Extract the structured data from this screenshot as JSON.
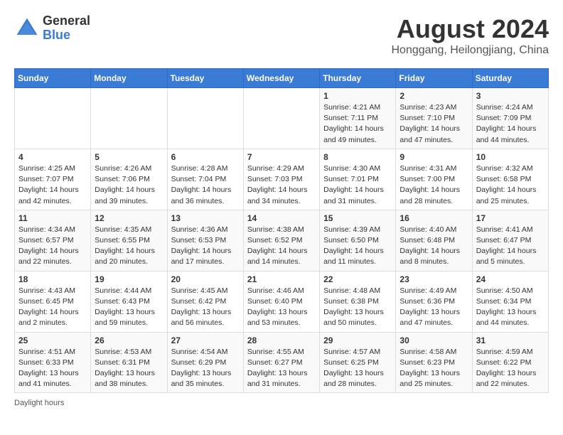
{
  "header": {
    "logo": {
      "general": "General",
      "blue": "Blue"
    },
    "title": "August 2024",
    "subtitle": "Honggang, Heilongjiang, China"
  },
  "calendar": {
    "weekdays": [
      "Sunday",
      "Monday",
      "Tuesday",
      "Wednesday",
      "Thursday",
      "Friday",
      "Saturday"
    ],
    "weeks": [
      [
        {
          "day": "",
          "info": ""
        },
        {
          "day": "",
          "info": ""
        },
        {
          "day": "",
          "info": ""
        },
        {
          "day": "",
          "info": ""
        },
        {
          "day": "1",
          "info": "Sunrise: 4:21 AM\nSunset: 7:11 PM\nDaylight: 14 hours\nand 49 minutes."
        },
        {
          "day": "2",
          "info": "Sunrise: 4:23 AM\nSunset: 7:10 PM\nDaylight: 14 hours\nand 47 minutes."
        },
        {
          "day": "3",
          "info": "Sunrise: 4:24 AM\nSunset: 7:09 PM\nDaylight: 14 hours\nand 44 minutes."
        }
      ],
      [
        {
          "day": "4",
          "info": "Sunrise: 4:25 AM\nSunset: 7:07 PM\nDaylight: 14 hours\nand 42 minutes."
        },
        {
          "day": "5",
          "info": "Sunrise: 4:26 AM\nSunset: 7:06 PM\nDaylight: 14 hours\nand 39 minutes."
        },
        {
          "day": "6",
          "info": "Sunrise: 4:28 AM\nSunset: 7:04 PM\nDaylight: 14 hours\nand 36 minutes."
        },
        {
          "day": "7",
          "info": "Sunrise: 4:29 AM\nSunset: 7:03 PM\nDaylight: 14 hours\nand 34 minutes."
        },
        {
          "day": "8",
          "info": "Sunrise: 4:30 AM\nSunset: 7:01 PM\nDaylight: 14 hours\nand 31 minutes."
        },
        {
          "day": "9",
          "info": "Sunrise: 4:31 AM\nSunset: 7:00 PM\nDaylight: 14 hours\nand 28 minutes."
        },
        {
          "day": "10",
          "info": "Sunrise: 4:32 AM\nSunset: 6:58 PM\nDaylight: 14 hours\nand 25 minutes."
        }
      ],
      [
        {
          "day": "11",
          "info": "Sunrise: 4:34 AM\nSunset: 6:57 PM\nDaylight: 14 hours\nand 22 minutes."
        },
        {
          "day": "12",
          "info": "Sunrise: 4:35 AM\nSunset: 6:55 PM\nDaylight: 14 hours\nand 20 minutes."
        },
        {
          "day": "13",
          "info": "Sunrise: 4:36 AM\nSunset: 6:53 PM\nDaylight: 14 hours\nand 17 minutes."
        },
        {
          "day": "14",
          "info": "Sunrise: 4:38 AM\nSunset: 6:52 PM\nDaylight: 14 hours\nand 14 minutes."
        },
        {
          "day": "15",
          "info": "Sunrise: 4:39 AM\nSunset: 6:50 PM\nDaylight: 14 hours\nand 11 minutes."
        },
        {
          "day": "16",
          "info": "Sunrise: 4:40 AM\nSunset: 6:48 PM\nDaylight: 14 hours\nand 8 minutes."
        },
        {
          "day": "17",
          "info": "Sunrise: 4:41 AM\nSunset: 6:47 PM\nDaylight: 14 hours\nand 5 minutes."
        }
      ],
      [
        {
          "day": "18",
          "info": "Sunrise: 4:43 AM\nSunset: 6:45 PM\nDaylight: 14 hours\nand 2 minutes."
        },
        {
          "day": "19",
          "info": "Sunrise: 4:44 AM\nSunset: 6:43 PM\nDaylight: 13 hours\nand 59 minutes."
        },
        {
          "day": "20",
          "info": "Sunrise: 4:45 AM\nSunset: 6:42 PM\nDaylight: 13 hours\nand 56 minutes."
        },
        {
          "day": "21",
          "info": "Sunrise: 4:46 AM\nSunset: 6:40 PM\nDaylight: 13 hours\nand 53 minutes."
        },
        {
          "day": "22",
          "info": "Sunrise: 4:48 AM\nSunset: 6:38 PM\nDaylight: 13 hours\nand 50 minutes."
        },
        {
          "day": "23",
          "info": "Sunrise: 4:49 AM\nSunset: 6:36 PM\nDaylight: 13 hours\nand 47 minutes."
        },
        {
          "day": "24",
          "info": "Sunrise: 4:50 AM\nSunset: 6:34 PM\nDaylight: 13 hours\nand 44 minutes."
        }
      ],
      [
        {
          "day": "25",
          "info": "Sunrise: 4:51 AM\nSunset: 6:33 PM\nDaylight: 13 hours\nand 41 minutes."
        },
        {
          "day": "26",
          "info": "Sunrise: 4:53 AM\nSunset: 6:31 PM\nDaylight: 13 hours\nand 38 minutes."
        },
        {
          "day": "27",
          "info": "Sunrise: 4:54 AM\nSunset: 6:29 PM\nDaylight: 13 hours\nand 35 minutes."
        },
        {
          "day": "28",
          "info": "Sunrise: 4:55 AM\nSunset: 6:27 PM\nDaylight: 13 hours\nand 31 minutes."
        },
        {
          "day": "29",
          "info": "Sunrise: 4:57 AM\nSunset: 6:25 PM\nDaylight: 13 hours\nand 28 minutes."
        },
        {
          "day": "30",
          "info": "Sunrise: 4:58 AM\nSunset: 6:23 PM\nDaylight: 13 hours\nand 25 minutes."
        },
        {
          "day": "31",
          "info": "Sunrise: 4:59 AM\nSunset: 6:22 PM\nDaylight: 13 hours\nand 22 minutes."
        }
      ]
    ]
  },
  "footer": {
    "note": "Daylight hours"
  }
}
